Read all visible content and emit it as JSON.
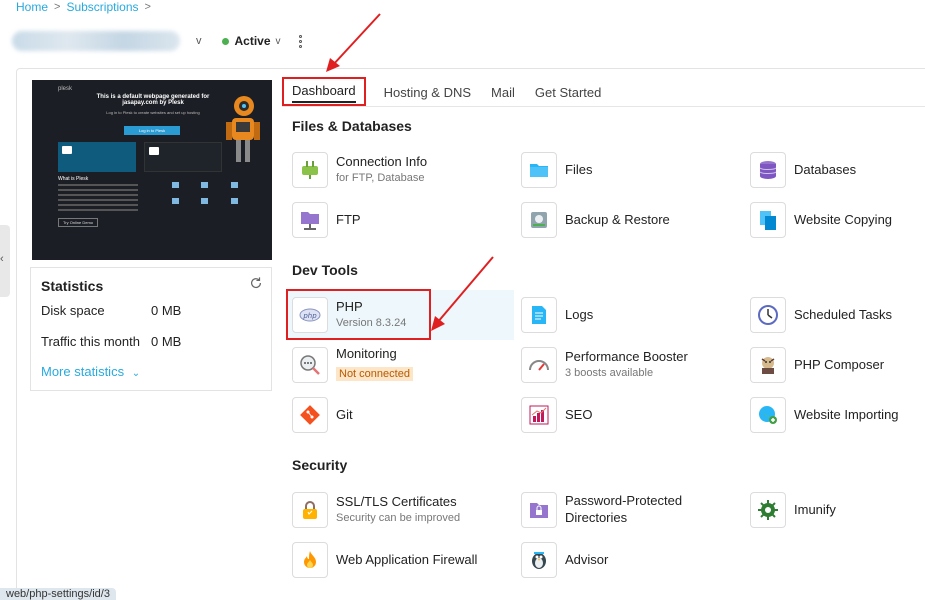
{
  "breadcrumb": {
    "home": "Home",
    "subscriptions": "Subscriptions",
    "sep": ">"
  },
  "header": {
    "status": "Active",
    "caret": "v"
  },
  "preview": {
    "logo": "plesk",
    "title": "This is a default webpage generated for jasapay.com by Plesk",
    "subtitle": "Log in to Plesk to create websites and set up hosting",
    "button": "Log in to Plesk",
    "what": "What is Plesk",
    "try_button": "Try Online Demo"
  },
  "stats": {
    "title": "Statistics",
    "disk_label": "Disk space",
    "disk_value": "0 MB",
    "traffic_label": "Traffic this month",
    "traffic_value": "0 MB",
    "more": "More statistics"
  },
  "tabs": [
    {
      "label": "Dashboard"
    },
    {
      "label": "Hosting & DNS"
    },
    {
      "label": "Mail"
    },
    {
      "label": "Get Started"
    }
  ],
  "sections": {
    "files": "Files & Databases",
    "dev": "Dev Tools",
    "security": "Security"
  },
  "tiles": {
    "connection": {
      "name": "Connection Info",
      "sub": "for FTP, Database"
    },
    "files": {
      "name": "Files"
    },
    "databases": {
      "name": "Databases"
    },
    "ftp": {
      "name": "FTP"
    },
    "backup": {
      "name": "Backup & Restore"
    },
    "copying": {
      "name": "Website Copying"
    },
    "php": {
      "name": "PHP",
      "sub": "Version 8.3.24"
    },
    "logs": {
      "name": "Logs"
    },
    "scheduled": {
      "name": "Scheduled Tasks"
    },
    "monitoring": {
      "name": "Monitoring",
      "badge": "Not connected"
    },
    "booster": {
      "name": "Performance Booster",
      "sub": "3 boosts available"
    },
    "composer": {
      "name": "PHP Composer"
    },
    "git": {
      "name": "Git"
    },
    "seo": {
      "name": "SEO"
    },
    "importing": {
      "name": "Website Importing"
    },
    "ssl": {
      "name": "SSL/TLS Certificates",
      "sub": "Security can be improved"
    },
    "password": {
      "name": "Password-Protected",
      "name2": "Directories"
    },
    "imunify": {
      "name": "Imunify"
    },
    "waf": {
      "name": "Web Application Firewall"
    },
    "advisor": {
      "name": "Advisor"
    }
  },
  "statusbar": {
    "url": "web/php-settings/id/3"
  },
  "colors": {
    "accent": "#28aade",
    "highlight": "#e02020",
    "active_dot": "#4caf50"
  }
}
